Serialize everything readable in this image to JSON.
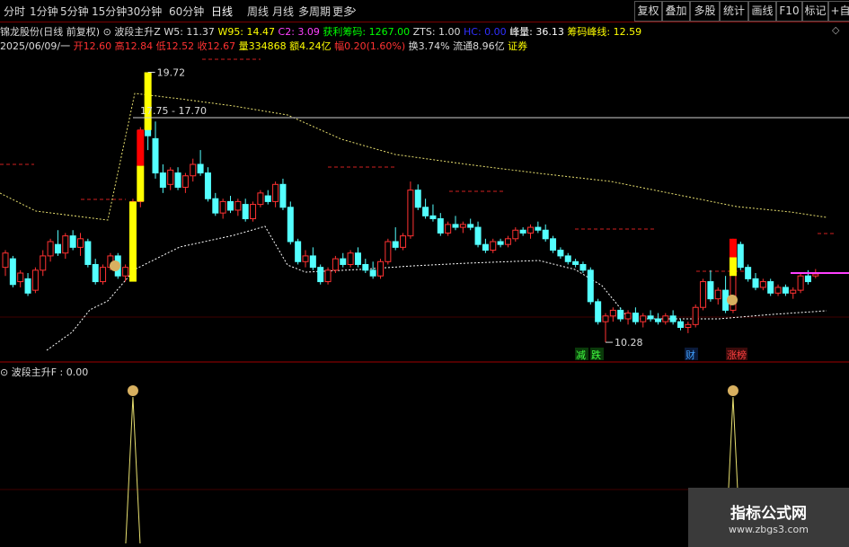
{
  "toolbar": {
    "periods": [
      "分时",
      "1分钟",
      "5分钟",
      "15分钟",
      "30分钟",
      "60分钟",
      "日线",
      "周线",
      "月线",
      "多周期",
      "更多"
    ],
    "active": "日线",
    "right_buttons": [
      "复权",
      "叠加",
      "多股",
      "统计",
      "画线",
      "F10",
      "标记",
      "+自"
    ]
  },
  "info_line1": {
    "stock": "锦龙股份(日线 前复权)",
    "indicator": "波段主升Z",
    "w5": "W5: 11.37",
    "w95": "W95: 14.47",
    "c2": "C2: 3.09",
    "profit_chips": "获利筹码: 1267.00",
    "zts": "ZTS: 1.00",
    "hc": "HC: 0.00",
    "peak": "峰量: 36.13",
    "peak_line": "筹码峰线: 12.59"
  },
  "info_line2": {
    "date": "2025/06/09/一",
    "open": "开12.60",
    "high": "高12.84",
    "low": "低12.52",
    "close": "收12.67",
    "volume": "量334868",
    "amount": "额4.24亿",
    "change": "幅0.20(1.60%)",
    "turnover": "换3.74%",
    "float": "流通8.96亿",
    "sector": "证券"
  },
  "sub_panel": {
    "label": "波段主升F : 0.00"
  },
  "annotations": {
    "high_label": "19.72",
    "low_label": "10.28",
    "range_label": "17.75 - 17.70",
    "tag_down": "减",
    "tag_fall": "跌",
    "tag_finance": "财",
    "tag_limit": "涨榜"
  },
  "watermark": {
    "title": "指标公式网",
    "url": "www.zbgs3.com"
  },
  "colors": {
    "up": "#ff3232",
    "down": "#54ffff",
    "signal": "#ffff00",
    "signal_red": "#ff0000",
    "chip_line": "#ffffff"
  },
  "chart_data": {
    "type": "candlestick",
    "ylim": [
      10.0,
      20.3
    ],
    "candles": [
      {
        "o": 12.9,
        "h": 13.5,
        "l": 12.6,
        "c": 13.4
      },
      {
        "o": 13.2,
        "h": 13.3,
        "l": 12.2,
        "c": 12.3
      },
      {
        "o": 12.4,
        "h": 12.8,
        "l": 12.2,
        "c": 12.7
      },
      {
        "o": 12.5,
        "h": 12.7,
        "l": 11.9,
        "c": 12.0
      },
      {
        "o": 12.1,
        "h": 12.9,
        "l": 12.0,
        "c": 12.8
      },
      {
        "o": 12.8,
        "h": 13.5,
        "l": 12.6,
        "c": 13.3
      },
      {
        "o": 13.3,
        "h": 13.9,
        "l": 13.1,
        "c": 13.8
      },
      {
        "o": 13.7,
        "h": 14.2,
        "l": 13.3,
        "c": 13.4
      },
      {
        "o": 13.4,
        "h": 14.1,
        "l": 13.2,
        "c": 14.0
      },
      {
        "o": 14.0,
        "h": 14.2,
        "l": 13.5,
        "c": 13.6
      },
      {
        "o": 13.6,
        "h": 14.1,
        "l": 13.3,
        "c": 13.9
      },
      {
        "o": 13.8,
        "h": 13.9,
        "l": 12.9,
        "c": 13.0
      },
      {
        "o": 13.0,
        "h": 13.2,
        "l": 12.3,
        "c": 12.4
      },
      {
        "o": 12.4,
        "h": 13.0,
        "l": 12.3,
        "c": 12.9
      },
      {
        "o": 12.9,
        "h": 13.4,
        "l": 12.8,
        "c": 13.3
      },
      {
        "o": 13.3,
        "h": 13.4,
        "l": 12.5,
        "c": 12.6
      },
      {
        "o": 12.6,
        "h": 13.0,
        "l": 12.4,
        "c": 12.9
      },
      {
        "o": 13.0,
        "h": 15.3,
        "l": 12.9,
        "c": 15.2
      },
      {
        "o": 15.2,
        "h": 17.8,
        "l": 15.0,
        "c": 17.7
      },
      {
        "o": 17.8,
        "h": 19.72,
        "l": 17.0,
        "c": 17.5
      },
      {
        "o": 17.4,
        "h": 18.0,
        "l": 16.0,
        "c": 16.2
      },
      {
        "o": 16.2,
        "h": 16.5,
        "l": 15.5,
        "c": 15.7
      },
      {
        "o": 15.8,
        "h": 16.4,
        "l": 15.6,
        "c": 16.3
      },
      {
        "o": 16.2,
        "h": 16.4,
        "l": 15.6,
        "c": 15.7
      },
      {
        "o": 15.7,
        "h": 16.2,
        "l": 15.5,
        "c": 16.1
      },
      {
        "o": 16.1,
        "h": 16.7,
        "l": 15.9,
        "c": 16.5
      },
      {
        "o": 16.5,
        "h": 17.0,
        "l": 16.1,
        "c": 16.2
      },
      {
        "o": 16.2,
        "h": 16.4,
        "l": 15.2,
        "c": 15.3
      },
      {
        "o": 15.3,
        "h": 15.5,
        "l": 14.7,
        "c": 14.8
      },
      {
        "o": 14.8,
        "h": 15.3,
        "l": 14.6,
        "c": 15.2
      },
      {
        "o": 15.2,
        "h": 15.4,
        "l": 14.8,
        "c": 14.9
      },
      {
        "o": 14.9,
        "h": 15.3,
        "l": 14.7,
        "c": 15.2
      },
      {
        "o": 15.1,
        "h": 15.3,
        "l": 14.5,
        "c": 14.6
      },
      {
        "o": 14.6,
        "h": 15.2,
        "l": 14.5,
        "c": 15.1
      },
      {
        "o": 15.1,
        "h": 15.6,
        "l": 15.0,
        "c": 15.5
      },
      {
        "o": 15.4,
        "h": 15.6,
        "l": 15.1,
        "c": 15.2
      },
      {
        "o": 15.2,
        "h": 15.9,
        "l": 15.0,
        "c": 15.8
      },
      {
        "o": 15.8,
        "h": 16.0,
        "l": 14.9,
        "c": 15.0
      },
      {
        "o": 15.0,
        "h": 15.2,
        "l": 13.7,
        "c": 13.8
      },
      {
        "o": 13.8,
        "h": 13.9,
        "l": 13.0,
        "c": 13.1
      },
      {
        "o": 13.1,
        "h": 13.5,
        "l": 12.9,
        "c": 13.3
      },
      {
        "o": 13.3,
        "h": 13.6,
        "l": 12.8,
        "c": 12.9
      },
      {
        "o": 12.9,
        "h": 13.0,
        "l": 12.3,
        "c": 12.4
      },
      {
        "o": 12.4,
        "h": 12.9,
        "l": 12.3,
        "c": 12.8
      },
      {
        "o": 12.8,
        "h": 13.3,
        "l": 12.7,
        "c": 13.2
      },
      {
        "o": 13.2,
        "h": 13.4,
        "l": 12.9,
        "c": 13.0
      },
      {
        "o": 13.0,
        "h": 13.5,
        "l": 12.9,
        "c": 13.4
      },
      {
        "o": 13.4,
        "h": 13.6,
        "l": 12.9,
        "c": 13.0
      },
      {
        "o": 13.0,
        "h": 13.2,
        "l": 12.7,
        "c": 12.8
      },
      {
        "o": 12.8,
        "h": 13.1,
        "l": 12.5,
        "c": 12.6
      },
      {
        "o": 12.6,
        "h": 13.2,
        "l": 12.5,
        "c": 13.1
      },
      {
        "o": 13.1,
        "h": 13.9,
        "l": 13.0,
        "c": 13.8
      },
      {
        "o": 13.8,
        "h": 14.3,
        "l": 13.5,
        "c": 13.6
      },
      {
        "o": 13.6,
        "h": 14.1,
        "l": 13.5,
        "c": 14.0
      },
      {
        "o": 14.0,
        "h": 15.9,
        "l": 13.9,
        "c": 15.6
      },
      {
        "o": 15.6,
        "h": 15.8,
        "l": 14.9,
        "c": 15.0
      },
      {
        "o": 15.0,
        "h": 15.3,
        "l": 14.6,
        "c": 14.7
      },
      {
        "o": 14.7,
        "h": 15.1,
        "l": 14.5,
        "c": 14.6
      },
      {
        "o": 14.6,
        "h": 14.8,
        "l": 14.0,
        "c": 14.1
      },
      {
        "o": 14.1,
        "h": 14.5,
        "l": 14.0,
        "c": 14.4
      },
      {
        "o": 14.4,
        "h": 14.7,
        "l": 14.2,
        "c": 14.3
      },
      {
        "o": 14.3,
        "h": 14.5,
        "l": 14.1,
        "c": 14.4
      },
      {
        "o": 14.4,
        "h": 14.6,
        "l": 14.2,
        "c": 14.3
      },
      {
        "o": 14.3,
        "h": 14.5,
        "l": 13.6,
        "c": 13.7
      },
      {
        "o": 13.7,
        "h": 13.9,
        "l": 13.4,
        "c": 13.5
      },
      {
        "o": 13.5,
        "h": 13.9,
        "l": 13.4,
        "c": 13.8
      },
      {
        "o": 13.8,
        "h": 13.9,
        "l": 13.6,
        "c": 13.7
      },
      {
        "o": 13.7,
        "h": 14.0,
        "l": 13.6,
        "c": 13.9
      },
      {
        "o": 13.9,
        "h": 14.3,
        "l": 13.8,
        "c": 14.2
      },
      {
        "o": 14.2,
        "h": 14.3,
        "l": 14.0,
        "c": 14.1
      },
      {
        "o": 14.1,
        "h": 14.4,
        "l": 13.9,
        "c": 14.3
      },
      {
        "o": 14.3,
        "h": 14.5,
        "l": 14.1,
        "c": 14.2
      },
      {
        "o": 14.2,
        "h": 14.4,
        "l": 13.8,
        "c": 13.9
      },
      {
        "o": 13.9,
        "h": 14.0,
        "l": 13.4,
        "c": 13.5
      },
      {
        "o": 13.5,
        "h": 13.6,
        "l": 13.2,
        "c": 13.3
      },
      {
        "o": 13.3,
        "h": 13.4,
        "l": 13.0,
        "c": 13.1
      },
      {
        "o": 13.1,
        "h": 13.2,
        "l": 12.9,
        "c": 13.0
      },
      {
        "o": 13.0,
        "h": 13.1,
        "l": 12.7,
        "c": 12.8
      },
      {
        "o": 12.8,
        "h": 12.9,
        "l": 11.6,
        "c": 11.7
      },
      {
        "o": 11.7,
        "h": 11.8,
        "l": 10.9,
        "c": 11.0
      },
      {
        "o": 11.0,
        "h": 11.3,
        "l": 10.28,
        "c": 11.2
      },
      {
        "o": 11.2,
        "h": 11.5,
        "l": 11.0,
        "c": 11.4
      },
      {
        "o": 11.4,
        "h": 11.5,
        "l": 11.0,
        "c": 11.1
      },
      {
        "o": 11.1,
        "h": 11.4,
        "l": 10.9,
        "c": 11.3
      },
      {
        "o": 11.3,
        "h": 11.5,
        "l": 10.9,
        "c": 11.0
      },
      {
        "o": 11.0,
        "h": 11.3,
        "l": 10.8,
        "c": 11.2
      },
      {
        "o": 11.2,
        "h": 11.4,
        "l": 11.0,
        "c": 11.1
      },
      {
        "o": 11.1,
        "h": 11.3,
        "l": 10.9,
        "c": 11.0
      },
      {
        "o": 11.0,
        "h": 11.3,
        "l": 10.9,
        "c": 11.2
      },
      {
        "o": 11.2,
        "h": 11.4,
        "l": 10.9,
        "c": 11.0
      },
      {
        "o": 11.0,
        "h": 11.1,
        "l": 10.7,
        "c": 10.8
      },
      {
        "o": 10.8,
        "h": 11.0,
        "l": 10.6,
        "c": 10.9
      },
      {
        "o": 10.9,
        "h": 11.6,
        "l": 10.8,
        "c": 11.5
      },
      {
        "o": 11.5,
        "h": 12.5,
        "l": 11.4,
        "c": 12.4
      },
      {
        "o": 12.4,
        "h": 12.8,
        "l": 11.7,
        "c": 11.8
      },
      {
        "o": 11.8,
        "h": 12.2,
        "l": 11.6,
        "c": 12.1
      },
      {
        "o": 12.1,
        "h": 12.6,
        "l": 11.3,
        "c": 11.4
      },
      {
        "o": 11.4,
        "h": 13.9,
        "l": 11.3,
        "c": 13.7
      },
      {
        "o": 13.7,
        "h": 13.8,
        "l": 12.8,
        "c": 12.9
      },
      {
        "o": 12.9,
        "h": 13.0,
        "l": 12.4,
        "c": 12.5
      },
      {
        "o": 12.5,
        "h": 12.7,
        "l": 12.1,
        "c": 12.2
      },
      {
        "o": 12.2,
        "h": 12.5,
        "l": 12.1,
        "c": 12.4
      },
      {
        "o": 12.4,
        "h": 12.5,
        "l": 11.9,
        "c": 12.0
      },
      {
        "o": 12.0,
        "h": 12.3,
        "l": 11.9,
        "c": 12.2
      },
      {
        "o": 12.2,
        "h": 12.3,
        "l": 11.9,
        "c": 12.0
      },
      {
        "o": 12.0,
        "h": 12.2,
        "l": 11.8,
        "c": 12.1
      },
      {
        "o": 12.1,
        "h": 12.7,
        "l": 12.0,
        "c": 12.6
      },
      {
        "o": 12.6,
        "h": 12.8,
        "l": 12.3,
        "c": 12.4
      },
      {
        "o": 12.6,
        "h": 12.84,
        "l": 12.52,
        "c": 12.67
      }
    ],
    "signal_bars": [
      {
        "index": 17,
        "from": 12.4,
        "to": 15.2,
        "color": "yellow"
      },
      {
        "index": 18,
        "from": 15.2,
        "to": 17.7,
        "color": "yellow_red"
      },
      {
        "index": 19,
        "from": 17.7,
        "to": 19.72,
        "color": "yellow"
      },
      {
        "index": 97,
        "from": 12.6,
        "to": 13.9,
        "color": "yellow_red"
      }
    ],
    "sub_signal_indices": [
      17,
      97
    ]
  }
}
